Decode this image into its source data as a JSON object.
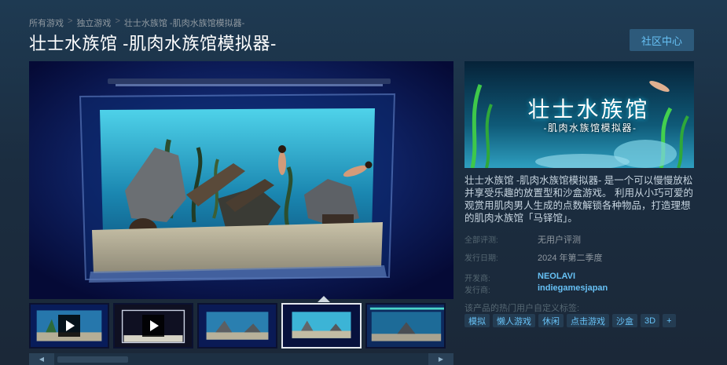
{
  "breadcrumb": {
    "items": [
      "所有游戏",
      "独立游戏",
      "壮士水族馆 -肌肉水族馆模拟器-"
    ],
    "separator": ">"
  },
  "page_title": "壮士水族馆 -肌肉水族馆模拟器-",
  "community_button": "社区中心",
  "media": {
    "selected_index": 3,
    "thumbnails": [
      {
        "kind": "video"
      },
      {
        "kind": "video"
      },
      {
        "kind": "screenshot"
      },
      {
        "kind": "screenshot"
      },
      {
        "kind": "screenshot"
      }
    ]
  },
  "capsule": {
    "title": "壮士水族馆",
    "subtitle": "-肌肉水族馆模拟器-"
  },
  "description": "壮士水族馆 -肌肉水族馆模拟器- 是一个可以慢慢放松并享受乐趣的放置型和沙盒游戏。 利用从小巧可爱的观赏用肌肉男人生成的点数解锁各种物品，打造理想的肌肉水族馆「马铎馆」。",
  "reviews": {
    "label": "全部评测:",
    "value": "无用户评测"
  },
  "release": {
    "label": "发行日期:",
    "value": "2024 年第二季度"
  },
  "developer": {
    "label": "开发商:",
    "value": "NEOLAVI"
  },
  "publisher": {
    "label": "发行商:",
    "value": "indiegamesjapan"
  },
  "tags_label": "该产品的热门用户自定义标签:",
  "tags": [
    "模拟",
    "懒人游戏",
    "休闲",
    "点击游戏",
    "沙盒",
    "3D",
    "+"
  ],
  "colors": {
    "background": "#1b2838",
    "link": "#67c1f5",
    "tag_bg": "#243c52",
    "button_bg": "#2d5a7b"
  },
  "icons": {
    "video_thumb": "play-icon",
    "scroll_left": "arrow-left-icon",
    "scroll_right": "arrow-right-icon"
  }
}
